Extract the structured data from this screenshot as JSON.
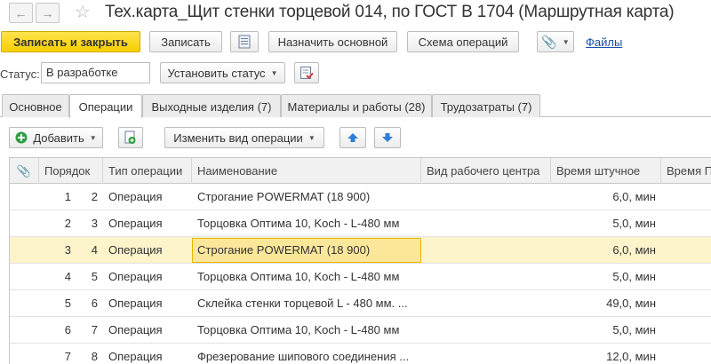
{
  "window": {
    "title": "Тех.карта_Щит стенки торцевой 014, по ГОСТ В 1704 (Маршрутная карта)"
  },
  "toolbar": {
    "save_close": "Записать и закрыть",
    "save": "Записать",
    "set_main": "Назначить основной",
    "ops_scheme": "Схема операций",
    "files": "Файлы"
  },
  "status": {
    "label": "Статус:",
    "value": "В разработке",
    "set_status": "Установить статус"
  },
  "tabs": [
    {
      "label": "Основное"
    },
    {
      "label": "Операции"
    },
    {
      "label": "Выходные изделия (7)"
    },
    {
      "label": "Материалы и работы (28)"
    },
    {
      "label": "Трудозатраты (7)"
    }
  ],
  "ops_toolbar": {
    "add": "Добавить",
    "change_view": "Изменить вид операции"
  },
  "table": {
    "columns": [
      "Порядок",
      "Тип операции",
      "Наименование",
      "Вид рабочего центра",
      "Время штучное",
      "Время П"
    ],
    "rows": [
      {
        "n": "1",
        "order": "2",
        "type": "Операция",
        "name": "Строгание POWERMAT (18 900)",
        "center": "",
        "time": "6,0, мин"
      },
      {
        "n": "2",
        "order": "3",
        "type": "Операция",
        "name": "Торцовка Оптима 10, Koch - L-480 мм",
        "center": "",
        "time": "5,0, мин"
      },
      {
        "n": "3",
        "order": "4",
        "type": "Операция",
        "name": "Строгание POWERMAT (18 900)",
        "center": "",
        "time": "6,0, мин"
      },
      {
        "n": "4",
        "order": "5",
        "type": "Операция",
        "name": "Торцовка Оптима 10, Koch - L-480 мм",
        "center": "",
        "time": "5,0, мин"
      },
      {
        "n": "5",
        "order": "6",
        "type": "Операция",
        "name": "Склейка стенки торцевой L - 480 мм. ...",
        "center": "",
        "time": "49,0, мин"
      },
      {
        "n": "6",
        "order": "7",
        "type": "Операция",
        "name": "Торцовка Оптима 10, Koch - L-480 мм",
        "center": "",
        "time": "5,0, мин"
      },
      {
        "n": "7",
        "order": "8",
        "type": "Операция",
        "name": "Фрезерование шипового соединения ...",
        "center": "",
        "time": "12,0, мин"
      }
    ]
  },
  "colors": {
    "primary_button": "#f7cf00",
    "selected_row": "#fdf4cc",
    "focus_cell": "#fbe79a",
    "link": "#1a4ea8",
    "arrow_blue": "#2f7fd6",
    "add_green": "#2ea043"
  }
}
